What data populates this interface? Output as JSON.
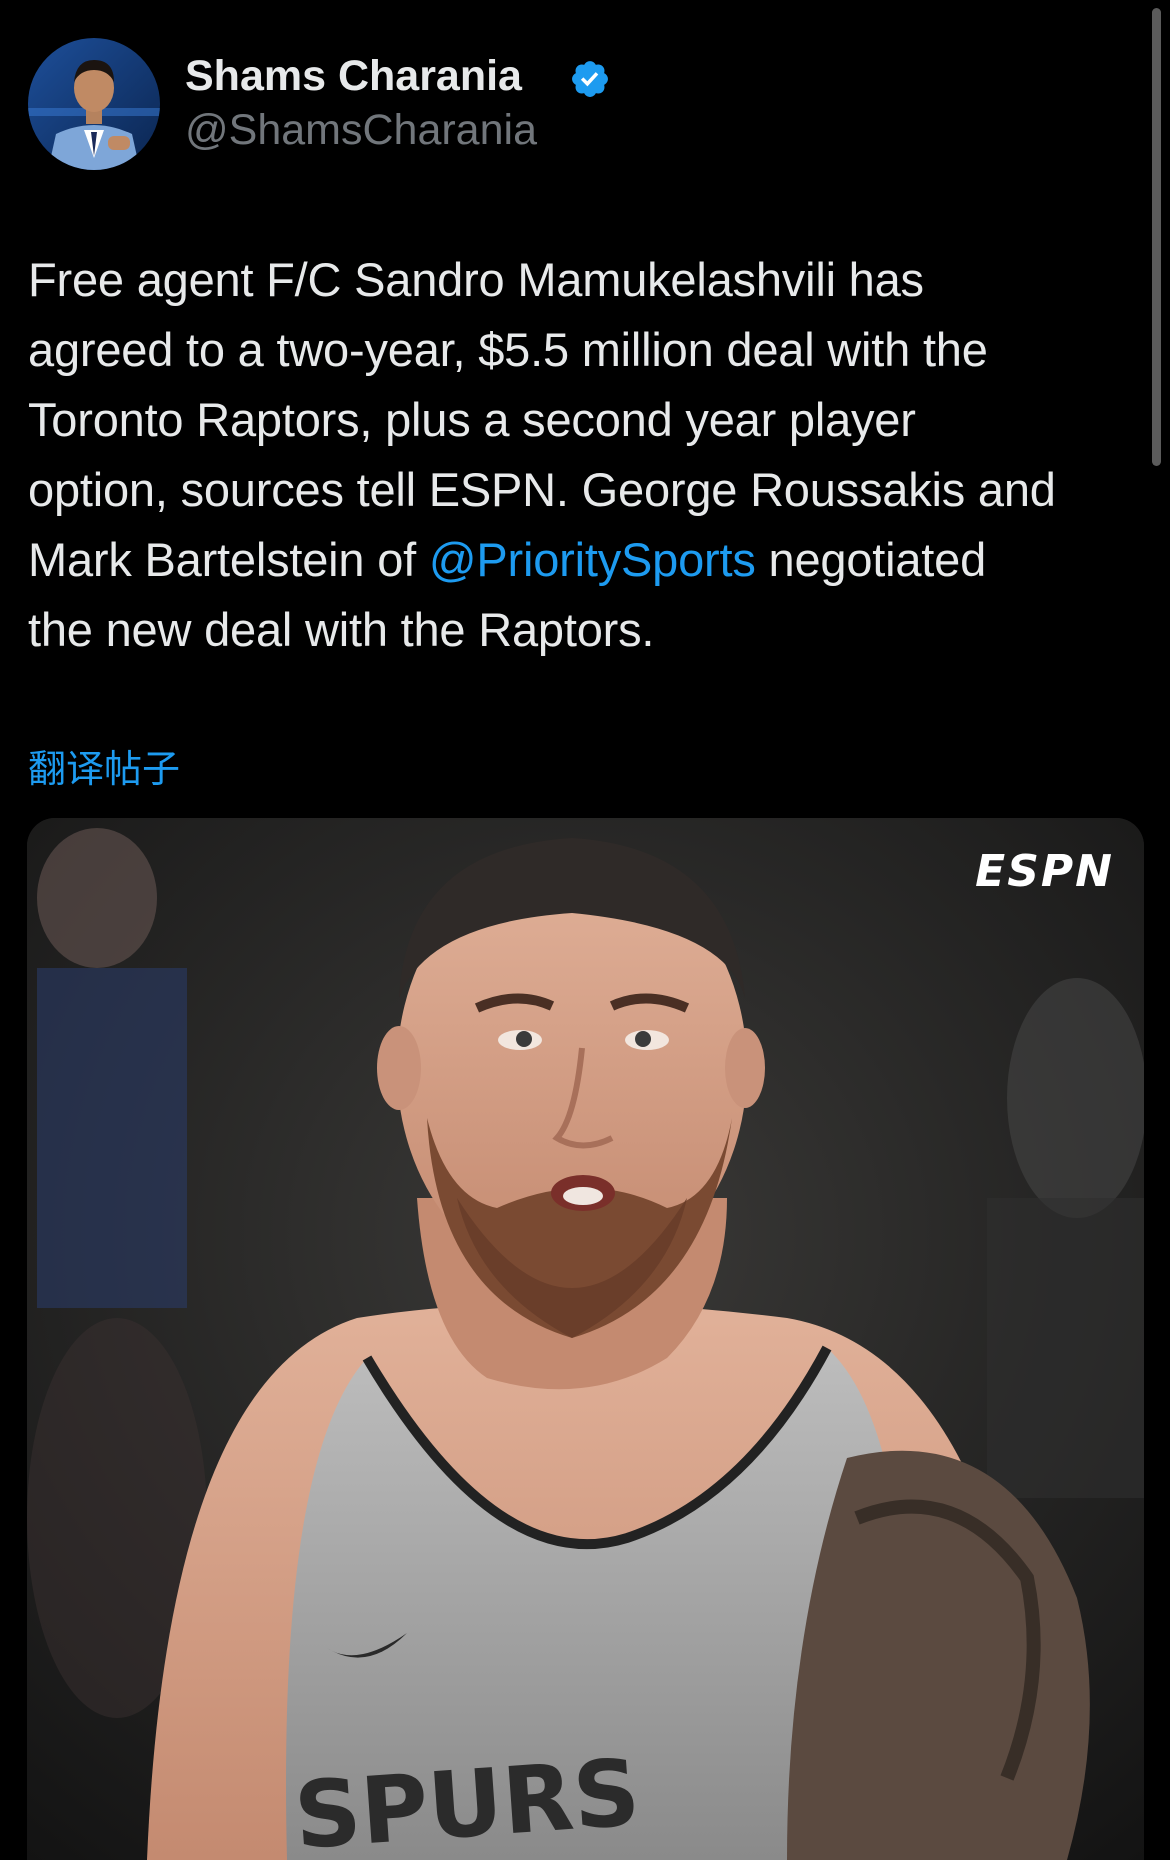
{
  "author": {
    "name": "Shams Charania",
    "handle": "@ShamsCharania",
    "verified": true,
    "verified_icon": "verified-badge-icon"
  },
  "tweet": {
    "lines": [
      {
        "text": "Free agent F/C Sandro Mamukelashvili has"
      },
      {
        "text": "agreed to a two-year, $5.5 million deal with the"
      },
      {
        "text": "Toronto Raptors, plus a second year player"
      },
      {
        "text": "option, sources tell ESPN. George Roussakis and"
      },
      {
        "pre": "Mark Bartelstein of ",
        "mention": "@PrioritySports",
        "post": " negotiated"
      },
      {
        "text": "the new deal with the Raptors."
      }
    ]
  },
  "translate_label": "翻译帖子",
  "media": {
    "watermark": "ESPN",
    "jersey_text": "SPURS"
  },
  "colors": {
    "background": "#000000",
    "text": "#e7e9ea",
    "secondary": "#71767b",
    "accent": "#1d9bf0"
  }
}
